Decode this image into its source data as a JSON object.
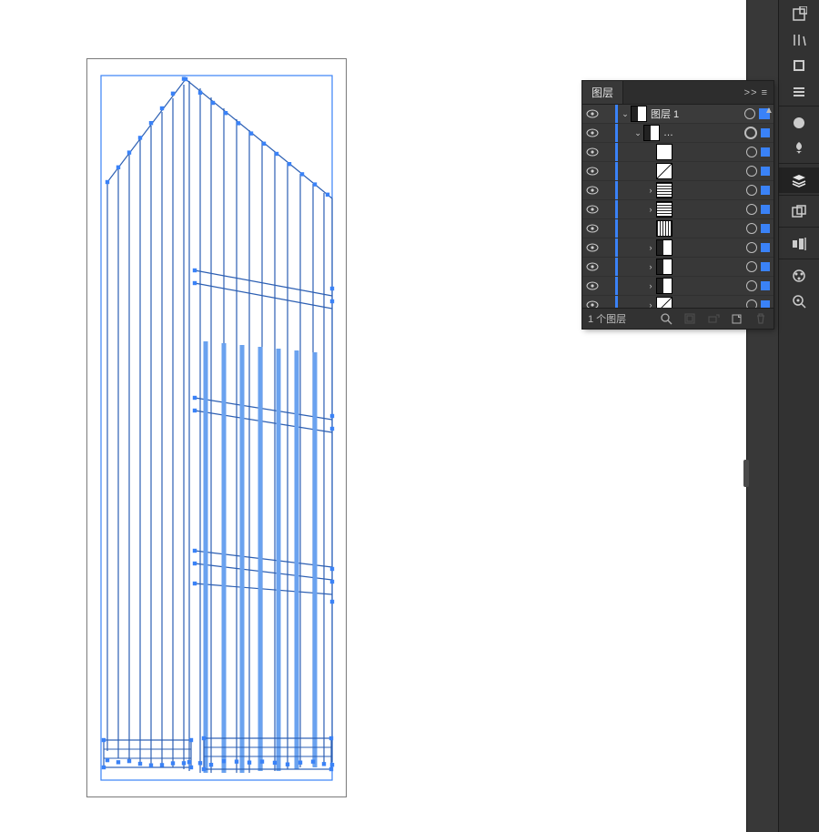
{
  "panel": {
    "title": "图层",
    "menu_glyph": ">> ≡",
    "footer_count": "1 个图层"
  },
  "layers": [
    {
      "indent": 0,
      "disclosure": "open",
      "thumb": "split",
      "label": "图层 1",
      "ring": "single",
      "sel": "big-filled"
    },
    {
      "indent": 1,
      "disclosure": "open",
      "thumb": "split",
      "label": "…",
      "ring": "double",
      "sel": "filled"
    },
    {
      "indent": 2,
      "disclosure": "",
      "thumb": "plain",
      "label": "",
      "ring": "single",
      "sel": "filled"
    },
    {
      "indent": 2,
      "disclosure": "",
      "thumb": "diag",
      "label": "",
      "ring": "single",
      "sel": "filled"
    },
    {
      "indent": 2,
      "disclosure": "closed",
      "thumb": "hatch",
      "label": "",
      "ring": "single",
      "sel": "filled"
    },
    {
      "indent": 2,
      "disclosure": "closed",
      "thumb": "hatch",
      "label": "",
      "ring": "single",
      "sel": "filled"
    },
    {
      "indent": 2,
      "disclosure": "",
      "thumb": "stripes",
      "label": "",
      "ring": "single",
      "sel": "filled"
    },
    {
      "indent": 2,
      "disclosure": "closed",
      "thumb": "split",
      "label": "",
      "ring": "single",
      "sel": "filled"
    },
    {
      "indent": 2,
      "disclosure": "closed",
      "thumb": "split",
      "label": "",
      "ring": "single",
      "sel": "filled"
    },
    {
      "indent": 2,
      "disclosure": "closed",
      "thumb": "split",
      "label": "",
      "ring": "single",
      "sel": "filled"
    },
    {
      "indent": 2,
      "disclosure": "closed",
      "thumb": "diag",
      "label": "",
      "ring": "single",
      "sel": "filled"
    }
  ],
  "dock_icons": [
    "properties-icon",
    "libraries-icon",
    "swatches-icon",
    "brushes-icon",
    "appearance-icon",
    "symbols-icon",
    "layers-icon",
    "artboards-icon",
    "align-icon",
    "color-guide-icon",
    "navigator-icon"
  ]
}
